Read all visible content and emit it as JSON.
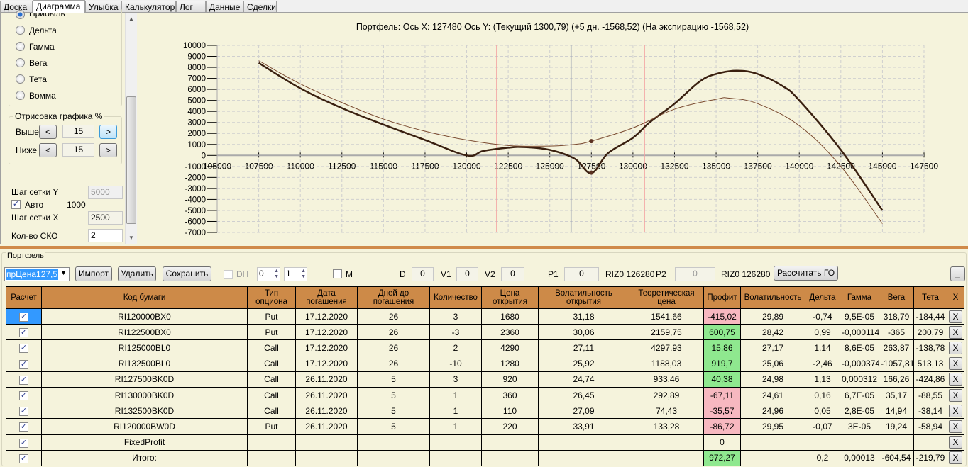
{
  "tabs": [
    "Доска",
    "Диаграмма",
    "Улыбка",
    "Калькулятор",
    "Лог",
    "Данные",
    "Сделки"
  ],
  "left": {
    "radios": [
      "Прибыль",
      "Дельта",
      "Гамма",
      "Вега",
      "Тета",
      "Вомма"
    ],
    "draw_group": "Отрисовка графика %",
    "above_label": "Выше",
    "above_value": "15",
    "below_label": "Ниже",
    "below_value": "15",
    "prev": "<",
    "next": ">",
    "grid_y_label": "Шаг сетки Y",
    "grid_y_value": "5000",
    "auto_label": "Авто",
    "auto_value": "1000",
    "grid_x_label": "Шаг сетки X",
    "grid_x_value": "2500",
    "sko_label": "Кол-во СКО",
    "sko_value": "2"
  },
  "chart_data": {
    "type": "line",
    "title": "Портфель: Ось X: 127480 Ось Y:  (Текущий 1300,79)  (+5 дн. -1568,52)  (На экспирацию -1568,52)",
    "xlim": [
      105000,
      147500
    ],
    "ylim": [
      -7000,
      10000
    ],
    "xticks": [
      "105000",
      "107500",
      "110000",
      "112500",
      "115000",
      "117500",
      "120000",
      "122500",
      "125000",
      "127500",
      "130000",
      "132500",
      "135000",
      "137500",
      "140000",
      "142500",
      "145000",
      "147500"
    ],
    "yticks": [
      "10000",
      "9000",
      "8000",
      "7000",
      "6000",
      "5000",
      "4000",
      "3000",
      "2000",
      "1000",
      "0",
      "-1000",
      "-2000",
      "-3000",
      "-4000",
      "-5000",
      "-6000",
      "-7000"
    ],
    "vlines": [
      {
        "x": 121800,
        "color": "#f4a0a0"
      },
      {
        "x": 130700,
        "color": "#f4a0a0"
      },
      {
        "x": 126280,
        "color": "#9aa0b0"
      }
    ],
    "series": [
      {
        "name": "expiration",
        "color": "#3a2010",
        "width": 2.5,
        "x": [
          107500,
          110000,
          112500,
          115000,
          117500,
          120000,
          121000,
          122500,
          123500,
          125000,
          126500,
          127500,
          128500,
          130000,
          131000,
          132500,
          134000,
          135000,
          136250,
          137500,
          139000,
          140000,
          142500,
          145000
        ],
        "y": [
          8400,
          6100,
          4300,
          2800,
          1400,
          0,
          400,
          700,
          750,
          500,
          -300,
          -1600,
          200,
          1600,
          3000,
          4700,
          6700,
          7400,
          7700,
          7400,
          6300,
          5000,
          500,
          -5000
        ]
      },
      {
        "name": "current",
        "color": "#7a4a30",
        "width": 1,
        "x": [
          107500,
          110000,
          112500,
          115000,
          117500,
          120000,
          122500,
          125000,
          126500,
          127500,
          130000,
          132500,
          135000,
          135800,
          137500,
          140000,
          142500,
          145000
        ],
        "y": [
          8600,
          6500,
          4800,
          3300,
          2200,
          1400,
          900,
          850,
          1000,
          1300,
          2500,
          4200,
          5100,
          5200,
          4700,
          2700,
          -1000,
          -6200
        ]
      }
    ],
    "markers": [
      {
        "x": 127500,
        "y": 1300
      },
      {
        "x": 127500,
        "y": -1568.52
      }
    ]
  },
  "portfolio": {
    "group": "Портфель",
    "combo": "прЦена127,5",
    "import": "Импорт",
    "delete": "Удалить",
    "save": "Сохранить",
    "dh": "DH",
    "spin1": "0",
    "spin2": "1",
    "m": "M",
    "d_label": "D",
    "d": "0",
    "v1_label": "V1",
    "v1": "0",
    "v2_label": "V2",
    "v2": "0",
    "p1_label": "P1",
    "p1": "0",
    "riz1": "RIZ0 126280",
    "p2_label": "P2",
    "p2": "0",
    "riz2": "RIZ0 126280",
    "calc": "Рассчитать ГО",
    "min": "_"
  },
  "table": {
    "headers": [
      "Расчет",
      "Код бумаги",
      "Тип опциона",
      "Дата погашения",
      "Дней до погашения",
      "Количество",
      "Цена открытия",
      "Волатильность открытия",
      "Теоретическая цена",
      "Профит",
      "Волатильность",
      "Дельта",
      "Гамма",
      "Вега",
      "Тета",
      "X"
    ],
    "rows": [
      [
        "RI120000BX0",
        "Put",
        "17.12.2020",
        "26",
        "3",
        "1680",
        "31,18",
        "1541,66",
        "-415,02",
        "29,89",
        "-0,74",
        "9,5E-05",
        "318,79",
        "-184,44"
      ],
      [
        "RI122500BX0",
        "Put",
        "17.12.2020",
        "26",
        "-3",
        "2360",
        "30,06",
        "2159,75",
        "600,75",
        "28,42",
        "0,99",
        "-0,000114",
        "-365",
        "200,79"
      ],
      [
        "RI125000BL0",
        "Call",
        "17.12.2020",
        "26",
        "2",
        "4290",
        "27,11",
        "4297,93",
        "15,86",
        "27,17",
        "1,14",
        "8,6E-05",
        "263,87",
        "-138,78"
      ],
      [
        "RI132500BL0",
        "Call",
        "17.12.2020",
        "26",
        "-10",
        "1280",
        "25,92",
        "1188,03",
        "919,7",
        "25,06",
        "-2,46",
        "-0,000374",
        "-1057,81",
        "513,13"
      ],
      [
        "RI127500BK0D",
        "Call",
        "26.11.2020",
        "5",
        "3",
        "920",
        "24,74",
        "933,46",
        "40,38",
        "24,98",
        "1,13",
        "0,000312",
        "166,26",
        "-424,86"
      ],
      [
        "RI130000BK0D",
        "Call",
        "26.11.2020",
        "5",
        "1",
        "360",
        "26,45",
        "292,89",
        "-67,11",
        "24,61",
        "0,16",
        "6,7E-05",
        "35,17",
        "-88,55"
      ],
      [
        "RI132500BK0D",
        "Call",
        "26.11.2020",
        "5",
        "1",
        "110",
        "27,09",
        "74,43",
        "-35,57",
        "24,96",
        "0,05",
        "2,8E-05",
        "14,94",
        "-38,14"
      ],
      [
        "RI120000BW0D",
        "Put",
        "26.11.2020",
        "5",
        "1",
        "220",
        "33,91",
        "133,28",
        "-86,72",
        "29,95",
        "-0,07",
        "3E-05",
        "19,24",
        "-58,94"
      ],
      [
        "FixedProfit",
        "",
        "",
        "",
        "",
        "",
        "",
        "",
        "0",
        "",
        "",
        "",
        "",
        ""
      ],
      [
        "Итого:",
        "",
        "",
        "",
        "",
        "",
        "",
        "",
        "972,27",
        "",
        "0,2",
        "0,00013",
        "-604,54",
        "-219,79"
      ]
    ],
    "profit_status": [
      "neg",
      "pos",
      "pos",
      "pos",
      "pos",
      "neg",
      "neg",
      "neg",
      "",
      "pos"
    ],
    "check": "✓",
    "x": "X"
  }
}
